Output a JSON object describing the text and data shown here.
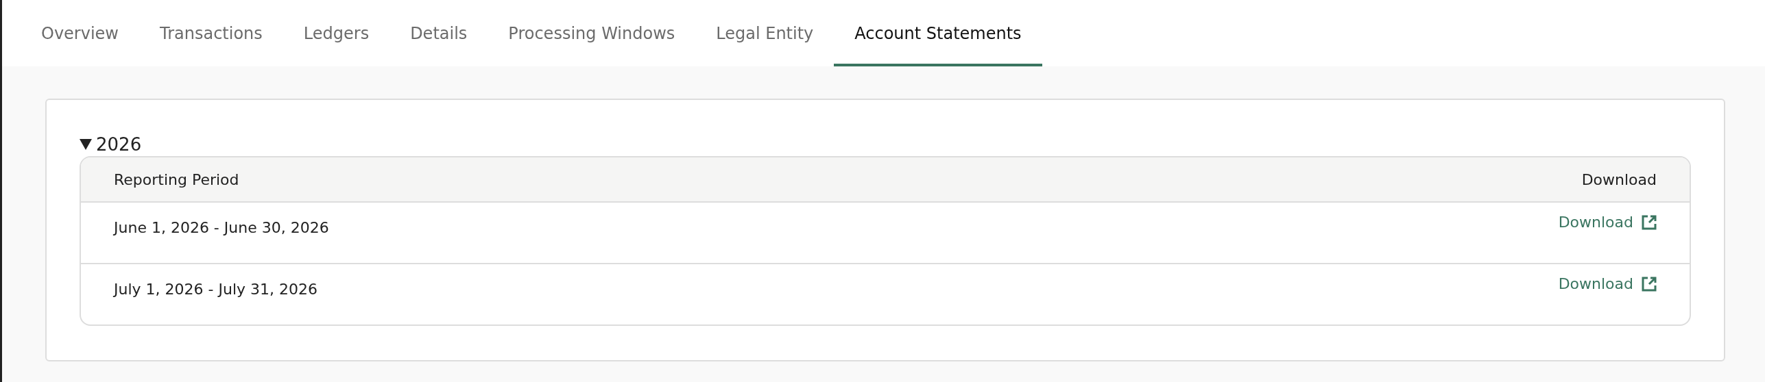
{
  "tabs": [
    {
      "label": "Overview",
      "selected": false
    },
    {
      "label": "Transactions",
      "selected": false
    },
    {
      "label": "Ledgers",
      "selected": false
    },
    {
      "label": "Details",
      "selected": false
    },
    {
      "label": "Processing Windows",
      "selected": false
    },
    {
      "label": "Legal Entity",
      "selected": false
    },
    {
      "label": "Account Statements",
      "selected": true
    }
  ],
  "group": {
    "label": "2026",
    "expanded": true,
    "table": {
      "columns": [
        "Reporting Period",
        "Download"
      ],
      "rows": [
        {
          "period": "June 1, 2026 - June 30, 2026",
          "link": "Download"
        },
        {
          "period": "July 1, 2026 - July 31, 2026",
          "link": "Download"
        }
      ]
    }
  }
}
